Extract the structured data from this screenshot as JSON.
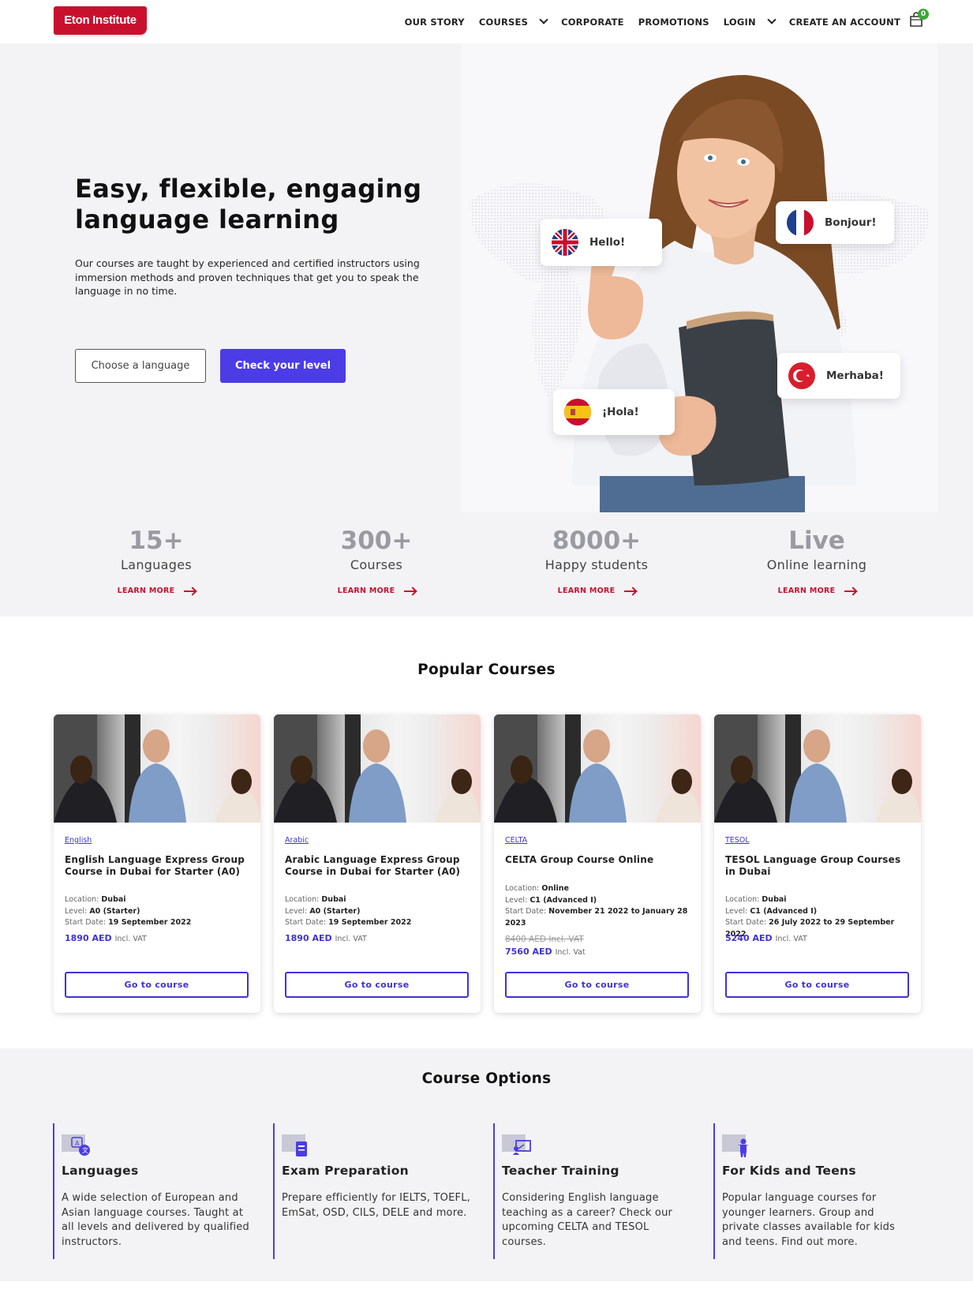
{
  "brand": {
    "logo_text": "Eton Institute",
    "primary_color": "#4b3ce6",
    "accent_color": "#c8102e"
  },
  "nav": {
    "items": [
      "OUR STORY",
      "COURSES",
      "CORPORATE",
      "PROMOTIONS",
      "LOGIN",
      "CREATE AN ACCOUNT"
    ],
    "cart_count": "0",
    "cart_icon": "shopping-bag-icon"
  },
  "hero": {
    "title": "Easy, flexible, engaging language learning",
    "description": "Our courses are taught by experienced and certified instructors using immersion methods and proven techniques that get you to speak the language in no time.",
    "choose_language": "Choose a language",
    "check_level": "Check your level",
    "greetings": [
      "Hello!",
      "Bonjour!",
      "Merhaba!",
      "¡Hola!"
    ]
  },
  "stats": [
    {
      "value": "15+",
      "label": "Languages",
      "link": "LEARN MORE"
    },
    {
      "value": "300+",
      "label": "Courses",
      "link": "LEARN MORE"
    },
    {
      "value": "8000+",
      "label": "Happy students",
      "link": "LEARN MORE"
    },
    {
      "value": "Live",
      "label": "Online learning",
      "link": "LEARN MORE"
    }
  ],
  "popular": {
    "title": "Popular Courses",
    "courses": [
      {
        "category": "English",
        "title": "English Language Express Group Course in Dubai for Starter (A0)",
        "location_label": "Location:",
        "location": "Dubai",
        "level_label": "Level:",
        "level": "A0 (Starter)",
        "start_label": "Start Date:",
        "start": "19 September 2022",
        "price": "1890 AED",
        "vat": "Incl. VAT",
        "button": "Go to course"
      },
      {
        "category": "Arabic",
        "title": "Arabic Language Express Group Course in Dubai for Starter (A0)",
        "location_label": "Location:",
        "location": "Dubai",
        "level_label": "Level:",
        "level": "A0 (Starter)",
        "start_label": "Start Date:",
        "start": "19 September 2022",
        "price": "1890 AED",
        "vat": "Incl. VAT",
        "button": "Go to course"
      },
      {
        "category": "CELTA",
        "title": "CELTA Group Course Online",
        "location_label": "Location:",
        "location": "Online",
        "level_label": "Level:",
        "level": "C1 (Advanced I)",
        "start_label": "Start Date:",
        "start": "November 21 2022 to January 28 2023",
        "old_price": "8400 AED",
        "old_vat": "Incl. VAT",
        "price": "7560 AED",
        "vat": "Incl. Vat",
        "button": "Go to course"
      },
      {
        "category": "TESOL",
        "title": "TESOL Language Group Courses in Dubai",
        "location_label": "Location:",
        "location": "Dubai",
        "level_label": "Level:",
        "level": "C1 (Advanced I)",
        "start_label": "Start Date:",
        "start": "26 July 2022 to 29 September 2022",
        "price": "5240 AED",
        "vat": "Incl. VAT",
        "button": "Go to course"
      }
    ]
  },
  "options": {
    "title": "Course Options",
    "items": [
      {
        "title": "Languages",
        "text": "A wide selection of European and Asian language courses. Taught at all levels and delivered by qualified instructors.",
        "icon": "translate-icon"
      },
      {
        "title": "Exam Preparation",
        "text": "Prepare efficiently for IELTS, TOEFL, EmSat, OSD, CILS, DELE and more.",
        "icon": "exam-book-icon"
      },
      {
        "title": "Teacher Training",
        "text": "Considering English language teaching as a career? Check our upcoming CELTA and TESOL courses.",
        "icon": "teacher-board-icon"
      },
      {
        "title": "For Kids and Teens",
        "text": "Popular language courses for younger learners. Group and private classes available for kids and teens. Find out more.",
        "icon": "child-icon"
      }
    ]
  }
}
